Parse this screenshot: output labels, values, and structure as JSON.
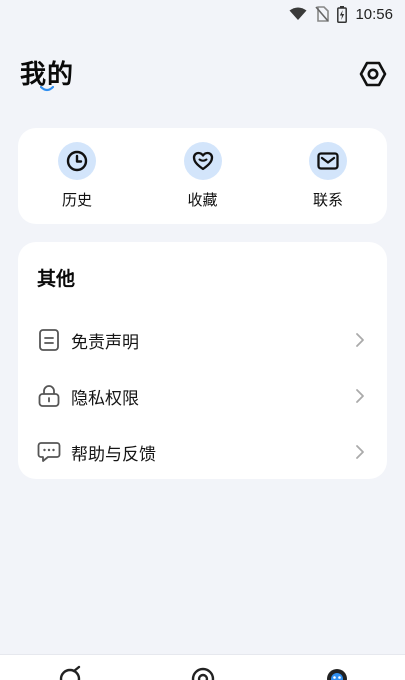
{
  "status_bar": {
    "time": "10:56"
  },
  "header": {
    "title": "我的",
    "settings_icon": "settings-hexagon-icon"
  },
  "quick_actions": [
    {
      "label": "历史",
      "icon": "clock-icon"
    },
    {
      "label": "收藏",
      "icon": "heart-icon"
    },
    {
      "label": "联系",
      "icon": "mail-icon"
    }
  ],
  "other": {
    "title": "其他",
    "items": [
      {
        "label": "免责声明",
        "icon": "document-icon"
      },
      {
        "label": "隐私权限",
        "icon": "lock-icon"
      },
      {
        "label": "帮助与反馈",
        "icon": "chat-bubble-icon"
      }
    ]
  },
  "bottom_nav": {
    "tabs": [
      {
        "icon": "discover-icon"
      },
      {
        "icon": "target-icon"
      },
      {
        "icon": "profile-icon"
      }
    ]
  },
  "colors": {
    "accent": "#2f8ef0",
    "icon_bg": "#d3e5fb",
    "background": "#f2f4f9"
  }
}
